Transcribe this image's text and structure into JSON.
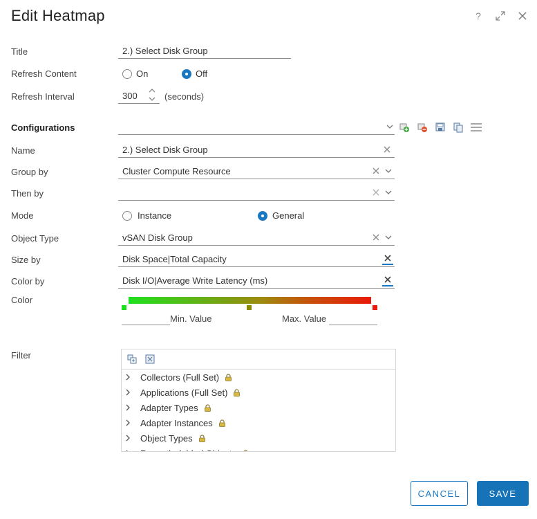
{
  "dialog": {
    "title": "Edit Heatmap"
  },
  "header_icons": [
    "help-icon",
    "expand-icon",
    "close-icon"
  ],
  "header_help_glyph": "?",
  "form": {
    "title_label": "Title",
    "title_value": "2.) Select Disk Group",
    "refresh_content_label": "Refresh Content",
    "refresh_on": "On",
    "refresh_off": "Off",
    "refresh_selected": "Off",
    "refresh_interval_label": "Refresh Interval",
    "refresh_interval_value": "300",
    "refresh_interval_unit": "(seconds)"
  },
  "configurations": {
    "label": "Configurations",
    "selected": "",
    "toolbar_icons": [
      "add-config-icon",
      "delete-config-icon",
      "save-config-icon",
      "clone-config-icon",
      "menu-icon"
    ]
  },
  "config": {
    "name_label": "Name",
    "name_value": "2.) Select Disk Group",
    "group_by_label": "Group by",
    "group_by_value": "Cluster Compute Resource",
    "then_by_label": "Then by",
    "then_by_value": "",
    "mode_label": "Mode",
    "mode_instance": "Instance",
    "mode_general": "General",
    "mode_selected": "General",
    "object_type_label": "Object Type",
    "object_type_value": "vSAN Disk Group",
    "size_by_label": "Size by",
    "size_by_value": "Disk Space|Total Capacity",
    "color_by_label": "Color by",
    "color_by_value": "Disk I/O|Average Write Latency (ms)",
    "color_label": "Color",
    "gradient_colors": {
      "min": "#1fe01f",
      "mid": "#8a8a00",
      "max": "#e81a0a"
    },
    "min_value_label": "Min. Value",
    "min_value": "",
    "max_value_label": "Max. Value",
    "max_value": ""
  },
  "filter": {
    "label": "Filter",
    "toolbar_icons": [
      "expand-all-icon",
      "collapse-all-icon"
    ],
    "items": [
      {
        "label": "Collectors (Full Set)",
        "locked": true
      },
      {
        "label": "Applications (Full Set)",
        "locked": true
      },
      {
        "label": "Adapter Types",
        "locked": true
      },
      {
        "label": "Adapter Instances",
        "locked": true
      },
      {
        "label": "Object Types",
        "locked": true
      },
      {
        "label": "Recently Added Objects",
        "locked": true
      }
    ]
  },
  "footer": {
    "cancel_label": "CANCEL",
    "save_label": "SAVE"
  }
}
